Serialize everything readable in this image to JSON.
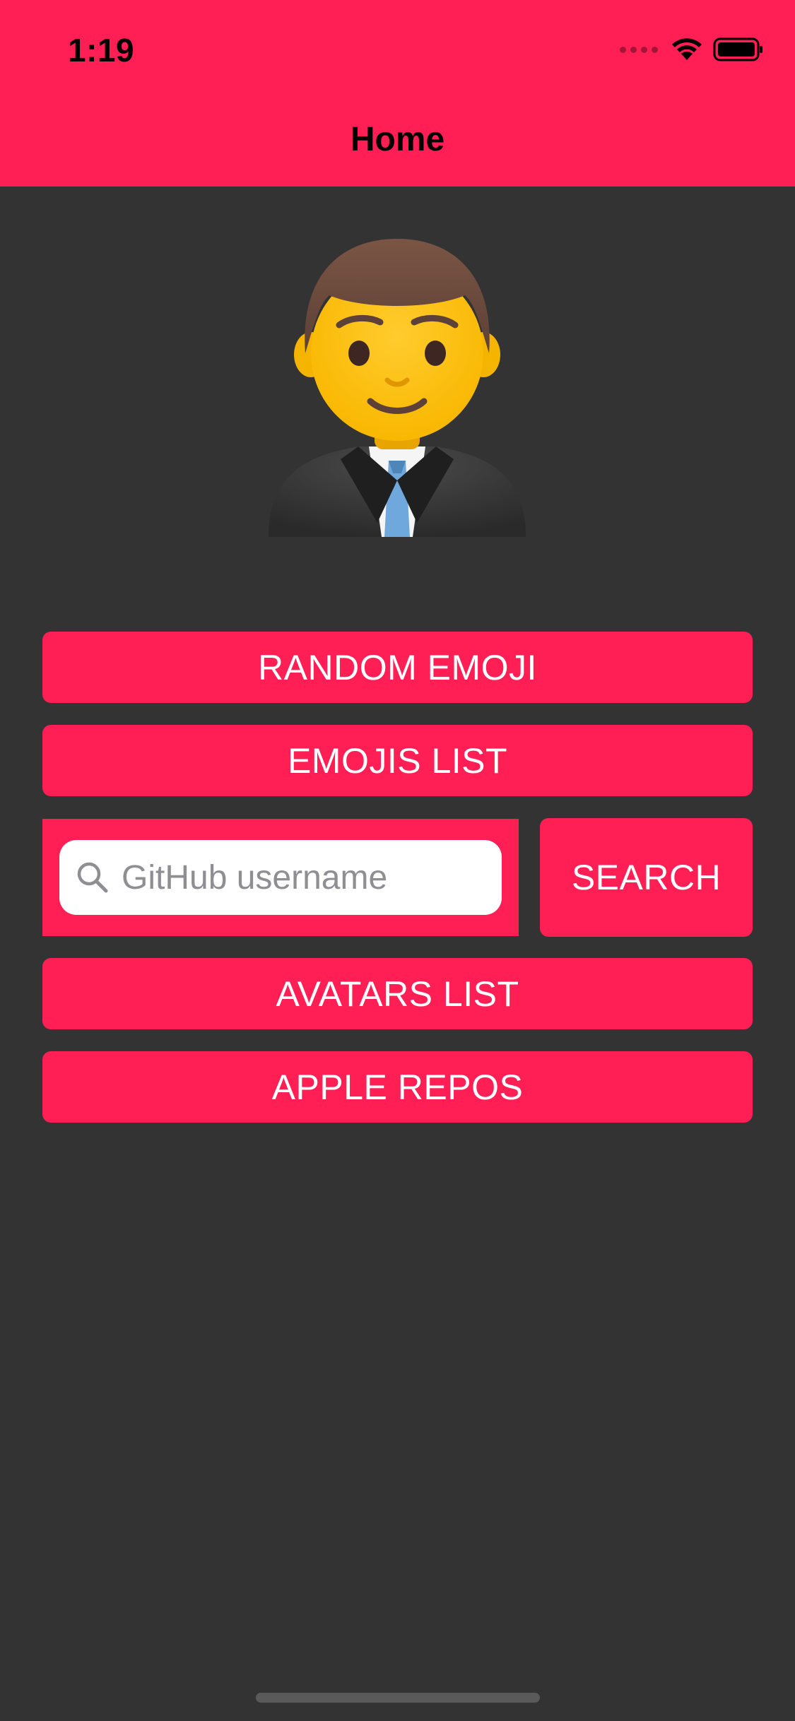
{
  "status_bar": {
    "time": "1:19"
  },
  "nav": {
    "title": "Home"
  },
  "avatar": {
    "emoji_name": "man-office-worker-icon"
  },
  "buttons": {
    "random_emoji": "RANDOM EMOJI",
    "emojis_list": "EMOJIS LIST",
    "search": "SEARCH",
    "avatars_list": "AVATARS LIST",
    "apple_repos": "APPLE REPOS"
  },
  "search": {
    "placeholder": "GitHub username",
    "value": ""
  },
  "colors": {
    "accent": "#FF1F55",
    "background": "#333333",
    "button_text": "#FFFFFF"
  }
}
